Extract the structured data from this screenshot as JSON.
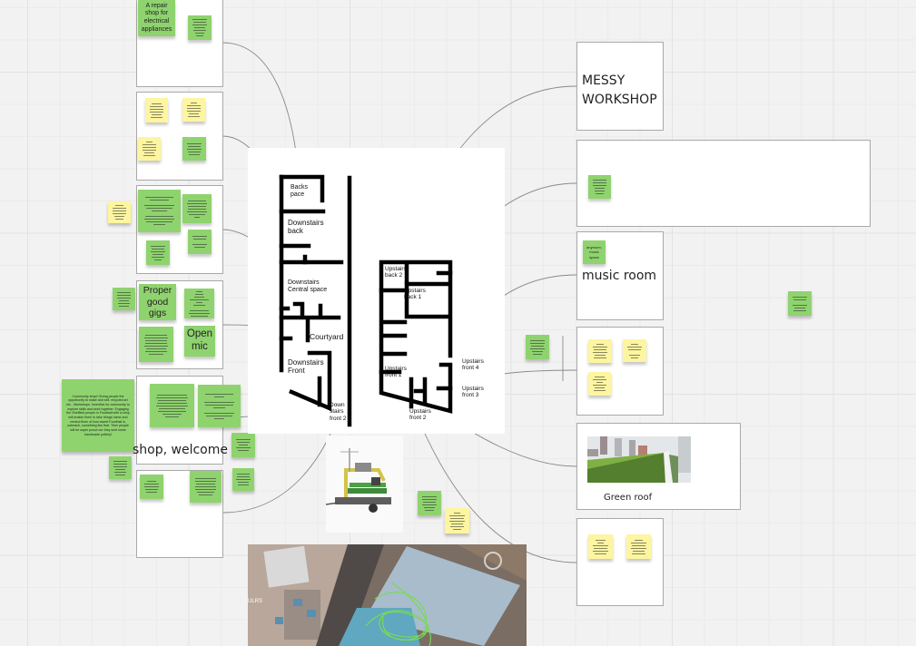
{
  "canvas": {
    "app": "whiteboard",
    "colors": {
      "background": "#f2f2f2",
      "grid_minor": "#ebebeb",
      "grid_major": "#e2e2e2",
      "frame_border": "#a9a9a9",
      "sticky_green": "#8fd36f",
      "sticky_yellow": "#fdf5a0",
      "connector": "#8a8a8a"
    }
  },
  "left_column": {
    "frame1": {
      "sticky_title": "A repair shop for electrical appliances"
    },
    "frame4": {
      "sticky_a": "Proper good gigs",
      "sticky_b": "Open mic"
    },
    "frame5": {
      "label": "shop, welcome"
    },
    "community_note": "Community shop! Giving people the opportunity to make and sell. recycled art etc.. Workshops. Incentive for community to explore skills and work together. Engaging the Sheffield people in Foodhall with a shop will enable them to take things home and remind them of how sweet Foodhall is, outreach, something like that. Then people will be super proud our they sold some handmade pottery!"
  },
  "floor_plan": {
    "downstairs": {
      "backspace": "Backs pace",
      "downstairs_back": "Downstairs back",
      "central": "Downstairs Central space",
      "courtyard": "Courtyard",
      "front": "Downstairs Front",
      "front2": "Down stairs front 2"
    },
    "upstairs": {
      "back2": "Upstairs back 2",
      "back1": "Upstairs back 1",
      "front1": "Upstairs front 1",
      "front2": "Upstairs front 2",
      "front3": "Upstairs front 3",
      "front4": "Upstairs front 4"
    }
  },
  "right_column": {
    "messy_workshop": "MESSY WORKSHOP",
    "music_room": {
      "label": "music room",
      "sticky": "anyroom, music space"
    },
    "green_roof": {
      "label": "Green roof",
      "image": "green-roof-photo"
    }
  },
  "images": {
    "trailer": "mobile-trailer-photo",
    "aerial": "aerial-map-photo"
  }
}
